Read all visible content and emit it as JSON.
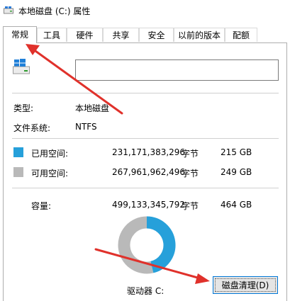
{
  "window": {
    "title": "本地磁盘 (C:) 属性"
  },
  "tabs": [
    {
      "label": "常规",
      "active": true
    },
    {
      "label": "工具"
    },
    {
      "label": "硬件"
    },
    {
      "label": "共享"
    },
    {
      "label": "安全"
    },
    {
      "label": "以前的版本"
    },
    {
      "label": "配额"
    }
  ],
  "general": {
    "name_value": "",
    "type_label": "类型:",
    "type_value": "本地磁盘",
    "fs_label": "文件系统:",
    "fs_value": "NTFS",
    "used": {
      "label": "已用空间:",
      "bytes": "231,171,383,296",
      "unit": "字节",
      "size": "215 GB",
      "color": "#26a0da"
    },
    "free": {
      "label": "可用空间:",
      "bytes": "267,961,962,496",
      "unit": "字节",
      "size": "249 GB",
      "color": "#b9b9b9"
    },
    "capacity": {
      "label": "容量:",
      "bytes": "499,133,345,792",
      "unit": "字节",
      "size": "464 GB"
    },
    "drive_label": "驱动器 C:",
    "cleanup_button": "磁盘清理(D)",
    "used_fraction": 0.463
  },
  "icons": {
    "title": "drive-icon",
    "drive": "windows-drive-icon"
  },
  "annotation_color": "#e0312b"
}
